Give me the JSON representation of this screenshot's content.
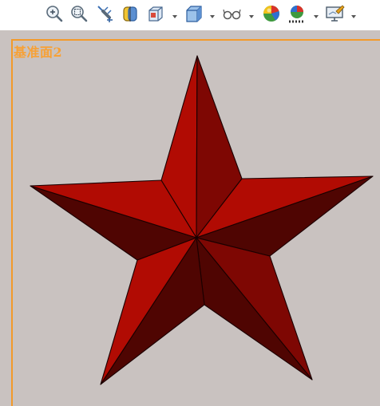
{
  "toolbar": {
    "buttons": [
      {
        "name": "zoom-to-fit-button",
        "icon": "zoom-to-fit-icon"
      },
      {
        "name": "zoom-to-area-button",
        "icon": "zoom-to-area-icon"
      },
      {
        "name": "previous-view-button",
        "icon": "previous-view-icon"
      },
      {
        "name": "section-view-button",
        "icon": "section-view-icon"
      },
      {
        "name": "view-orientation-button",
        "icon": "view-orientation-icon",
        "dropdown": true
      },
      {
        "name": "display-style-button",
        "icon": "display-style-icon",
        "dropdown": true
      },
      {
        "name": "hide-show-items-button",
        "icon": "glasses-icon",
        "dropdown": true
      },
      {
        "name": "edit-appearance-button",
        "icon": "appearance-sphere-icon"
      },
      {
        "name": "apply-scene-button",
        "icon": "scene-icon",
        "dropdown": true
      },
      {
        "name": "view-settings-button",
        "icon": "monitor-settings-icon",
        "dropdown": true
      }
    ]
  },
  "viewport": {
    "plane_label": "基准面2",
    "colors": {
      "background": "#c9c2c0",
      "plane_border": "#f39a2a",
      "plane_label": "#f7a136",
      "star_light": "#b10b03",
      "star_mid": "#7e0703",
      "star_dark": "#4f0502"
    }
  }
}
